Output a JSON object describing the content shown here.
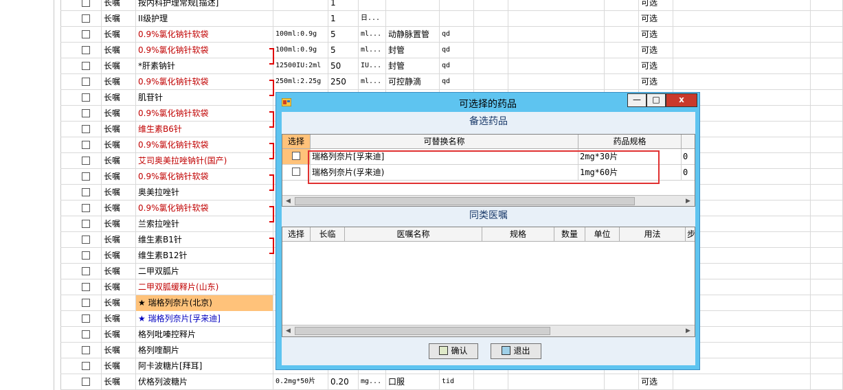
{
  "orders": {
    "rows": [
      {
        "type": "长嘱",
        "name": "按内科护理常规[描述]",
        "name_color": "black",
        "spec": "",
        "qty": "1",
        "unit": "",
        "route": "",
        "freq": "",
        "opt": "可选"
      },
      {
        "type": "长嘱",
        "name": "II级护理",
        "name_color": "black",
        "spec": "",
        "qty": "1",
        "unit": "日...",
        "route": "",
        "freq": "",
        "opt": "可选"
      },
      {
        "type": "长嘱",
        "name": "0.9%氯化钠针软袋",
        "name_color": "red",
        "spec": "100ml:0.9g",
        "qty": "5",
        "unit": "ml...",
        "route": "动静脉置管",
        "freq": "qd",
        "opt": "可选"
      },
      {
        "type": "长嘱",
        "name": "0.9%氯化钠针软袋",
        "name_color": "red",
        "spec": "100ml:0.9g",
        "qty": "5",
        "unit": "ml...",
        "route": "封管",
        "freq": "qd",
        "opt": "可选"
      },
      {
        "type": "长嘱",
        "name": "*肝素钠针",
        "name_color": "black",
        "spec": "12500IU:2ml",
        "qty": "50",
        "unit": "IU...",
        "route": "封管",
        "freq": "qd",
        "opt": "可选"
      },
      {
        "type": "长嘱",
        "name": "0.9%氯化钠针软袋",
        "name_color": "red",
        "spec": "250ml:2.25g",
        "qty": "250",
        "unit": "ml...",
        "route": "可控静滴",
        "freq": "qd",
        "opt": "可选"
      },
      {
        "type": "长嘱",
        "name": "肌苷针",
        "name_color": "black",
        "spec": "",
        "qty": "",
        "unit": "",
        "route": "",
        "freq": "",
        "opt": ""
      },
      {
        "type": "长嘱",
        "name": "0.9%氯化钠针软袋",
        "name_color": "red",
        "spec": "",
        "qty": "",
        "unit": "",
        "route": "",
        "freq": "",
        "opt": ""
      },
      {
        "type": "长嘱",
        "name": "维生素B6针",
        "name_color": "red",
        "spec": "",
        "qty": "",
        "unit": "",
        "route": "",
        "freq": "",
        "opt": ""
      },
      {
        "type": "长嘱",
        "name": "0.9%氯化钠针软袋",
        "name_color": "red",
        "spec": "",
        "qty": "",
        "unit": "",
        "route": "",
        "freq": "",
        "opt": ""
      },
      {
        "type": "长嘱",
        "name": "艾司奥美拉唑钠针(国产)",
        "name_color": "red",
        "spec": "",
        "qty": "",
        "unit": "",
        "route": "",
        "freq": "",
        "opt": ""
      },
      {
        "type": "长嘱",
        "name": "0.9%氯化钠针软袋",
        "name_color": "red",
        "spec": "",
        "qty": "",
        "unit": "",
        "route": "",
        "freq": "",
        "opt": ""
      },
      {
        "type": "长嘱",
        "name": "奥美拉唑针",
        "name_color": "black",
        "spec": "",
        "qty": "",
        "unit": "",
        "route": "",
        "freq": "",
        "opt": ""
      },
      {
        "type": "长嘱",
        "name": "0.9%氯化钠针软袋",
        "name_color": "red",
        "spec": "",
        "qty": "",
        "unit": "",
        "route": "",
        "freq": "",
        "opt": ""
      },
      {
        "type": "长嘱",
        "name": "兰索拉唑针",
        "name_color": "black",
        "spec": "",
        "qty": "",
        "unit": "",
        "route": "",
        "freq": "",
        "opt": ""
      },
      {
        "type": "长嘱",
        "name": "维生素B1针",
        "name_color": "black",
        "spec": "",
        "qty": "",
        "unit": "",
        "route": "",
        "freq": "",
        "opt": ""
      },
      {
        "type": "长嘱",
        "name": "维生素B12针",
        "name_color": "black",
        "spec": "",
        "qty": "",
        "unit": "",
        "route": "",
        "freq": "",
        "opt": ""
      },
      {
        "type": "长嘱",
        "name": "二甲双胍片",
        "name_color": "black",
        "spec": "",
        "qty": "",
        "unit": "",
        "route": "",
        "freq": "",
        "opt": ""
      },
      {
        "type": "长嘱",
        "name": "二甲双胍缓释片(山东)",
        "name_color": "red",
        "spec": "",
        "qty": "",
        "unit": "",
        "route": "",
        "freq": "",
        "opt": ""
      },
      {
        "type": "长嘱",
        "name": "★ 瑞格列奈片(北京)",
        "name_color": "black",
        "highlight": true,
        "spec": "",
        "qty": "",
        "unit": "",
        "route": "",
        "freq": "",
        "opt": ""
      },
      {
        "type": "长嘱",
        "name": "★ 瑞格列奈片[孚来迪]",
        "name_color": "blue",
        "spec": "",
        "qty": "",
        "unit": "",
        "route": "",
        "freq": "",
        "opt": ""
      },
      {
        "type": "长嘱",
        "name": "格列吡嗪控释片",
        "name_color": "black",
        "spec": "",
        "qty": "",
        "unit": "",
        "route": "",
        "freq": "",
        "opt": ""
      },
      {
        "type": "长嘱",
        "name": "格列喹酮片",
        "name_color": "black",
        "spec": "",
        "qty": "",
        "unit": "",
        "route": "",
        "freq": "",
        "opt": ""
      },
      {
        "type": "长嘱",
        "name": "阿卡波糖片[拜耳]",
        "name_color": "black",
        "spec": "",
        "qty": "",
        "unit": "",
        "route": "",
        "freq": "",
        "opt": ""
      },
      {
        "type": "长嘱",
        "name": "伏格列波糖片",
        "name_color": "black",
        "spec": "0.2mg*50片",
        "qty": "0.20",
        "unit": "mg...",
        "route": "口服",
        "freq": "tid",
        "opt": "可选"
      }
    ]
  },
  "dialog": {
    "title": "可选择的药品",
    "minimize_label": "—",
    "maximize_label": "□",
    "close_label": "x",
    "alt_section_title": "备选药品",
    "alt_columns": [
      "选择",
      "可替换名称",
      "药品规格"
    ],
    "alt_rows": [
      {
        "name": "瑞格列奈片[孚来迪]",
        "spec": "2mg*30片",
        "extra": "0"
      },
      {
        "name": "瑞格列奈片(孚来迪)",
        "spec": "1mg*60片",
        "extra": "0"
      }
    ],
    "same_section_title": "同类医嘱",
    "same_columns": [
      "选择",
      "长临",
      "医嘱名称",
      "规格",
      "数量",
      "单位",
      "用法",
      "步"
    ],
    "confirm_label": "确认",
    "exit_label": "退出"
  },
  "colors": {
    "accent": "#5ec4f0",
    "red_text": "#c00000",
    "blue_text": "#0000c0",
    "highlight": "#ffc27a",
    "close_button": "#c9392b"
  }
}
